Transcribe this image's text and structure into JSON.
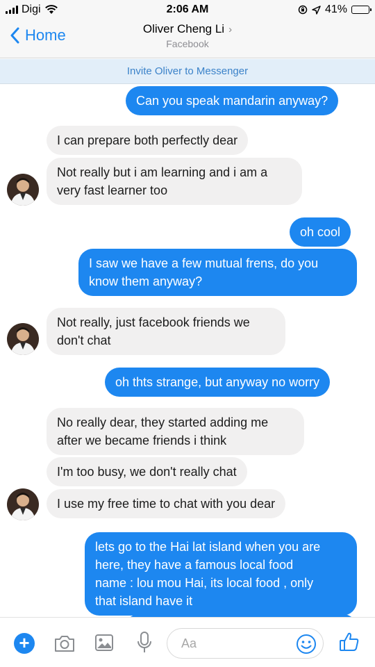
{
  "status_bar": {
    "carrier": "Digi",
    "time": "2:06 AM",
    "battery_percent": "41%",
    "battery_level": 0.41,
    "icons": [
      "signal-bars-icon",
      "wifi-icon",
      "rotation-lock-icon",
      "location-arrow-icon",
      "battery-icon"
    ]
  },
  "header": {
    "back_label": "Home",
    "contact_name": "Oliver Cheng Li",
    "subtitle": "Facebook",
    "chevron": "›"
  },
  "invite_bar": {
    "label": "Invite Oliver to Messenger"
  },
  "messages": [
    {
      "from": "me",
      "text": "Can you speak mandarin anyway?"
    },
    {
      "from": "them",
      "text": "I can prepare both perfectly dear"
    },
    {
      "from": "them",
      "line1": "Not really but i am learning and i am a",
      "line2": "very fast learner too"
    },
    {
      "from": "me",
      "text": "oh cool"
    },
    {
      "from": "me",
      "line1": "I saw we  have a few mutual frens, do you",
      "line2": "know them anyway?"
    },
    {
      "from": "them",
      "line1": "Not really, just facebook friends we",
      "line2": "don't chat"
    },
    {
      "from": "me",
      "text": "oh thts strange, but anyway no worry"
    },
    {
      "from": "them",
      "line1": "No really dear, they started adding me",
      "line2": "after we became friends i think"
    },
    {
      "from": "them",
      "text": "I'm too busy, we don't really chat"
    },
    {
      "from": "them",
      "text": "I use my free time to chat with you dear"
    },
    {
      "from": "me",
      "line1": "lets go to the Hai lat island when you are",
      "line2": "here, they have a famous local food",
      "line3": "name : lou mou Hai, its local food , only",
      "line4": "that island have it"
    }
  ],
  "composer": {
    "placeholder": "Aa"
  },
  "toolbar": {
    "icons": [
      "plus-icon",
      "camera-icon",
      "image-icon",
      "microphone-icon",
      "emoji-icon",
      "thumbs-up-icon"
    ]
  },
  "colors": {
    "accent": "#1d87f0",
    "incoming_bubble": "#f1f0f0",
    "invite_bg": "#e2eef9"
  }
}
